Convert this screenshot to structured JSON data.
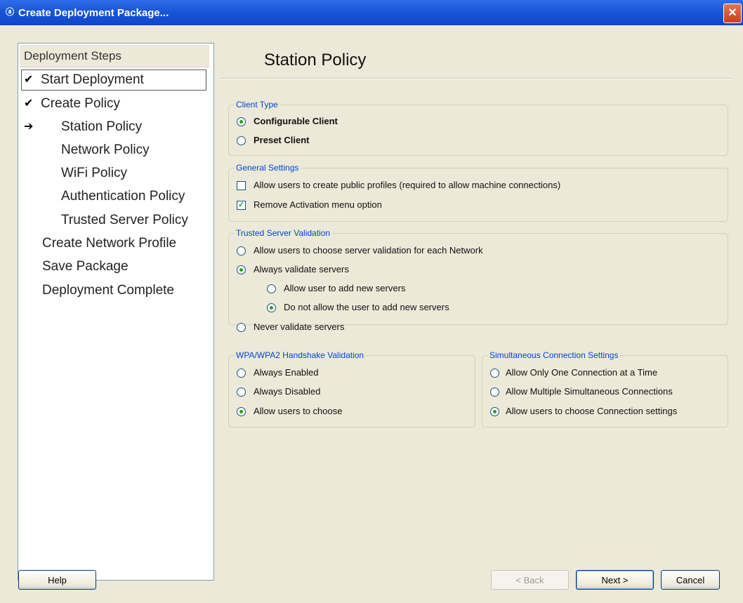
{
  "window": {
    "title": "Create Deployment Package...",
    "close_glyph": "✕"
  },
  "steps": {
    "header": "Deployment Steps",
    "items": [
      {
        "label": "Start Deployment",
        "mark": "✔"
      },
      {
        "label": "Create Policy",
        "mark": "✔"
      },
      {
        "label": "Station Policy",
        "mark": "➔"
      },
      {
        "label": "Network Policy",
        "mark": ""
      },
      {
        "label": "WiFi Policy",
        "mark": ""
      },
      {
        "label": "Authentication Policy",
        "mark": ""
      },
      {
        "label": "Trusted Server Policy",
        "mark": ""
      },
      {
        "label": "Create Network Profile",
        "mark": ""
      },
      {
        "label": "Save Package",
        "mark": ""
      },
      {
        "label": "Deployment Complete",
        "mark": ""
      }
    ]
  },
  "page": {
    "title": "Station Policy"
  },
  "client_type": {
    "legend": "Client Type",
    "options": [
      "Configurable Client",
      "Preset Client"
    ],
    "selected": "Configurable Client"
  },
  "general_settings": {
    "legend": "General Settings",
    "public_profiles": {
      "label": "Allow users to create public profiles (required to allow machine connections)",
      "checked": false
    },
    "remove_activation": {
      "label": "Remove Activation menu option",
      "checked": true,
      "check_glyph": "✓"
    }
  },
  "trusted_server": {
    "legend": "Trusted Server Validation",
    "options": [
      "Allow users to choose server validation for each Network",
      "Always validate servers",
      "Allow user to add new servers",
      "Do not allow the user to add new servers",
      "Never validate servers"
    ],
    "selected": "Always validate servers",
    "sub_selected": "Do not allow the user to add new servers"
  },
  "wpa_handshake": {
    "legend": "WPA/WPA2 Handshake Validation",
    "options": [
      "Always Enabled",
      "Always Disabled",
      "Allow users to choose"
    ],
    "selected": "Allow users to choose"
  },
  "simultaneous": {
    "legend": "Simultaneous Connection Settings",
    "options": [
      "Allow Only One Connection at a Time",
      "Allow Multiple Simultaneous Connections",
      "Allow users to choose Connection settings"
    ],
    "selected": "Allow users to choose Connection settings"
  },
  "buttons": {
    "help": "Help",
    "back": "< Back",
    "next": "Next >",
    "cancel": "Cancel"
  },
  "colors": {
    "title_bar": "#1a55d8",
    "legend_text": "#0046d5",
    "radio_selected": "#21a121"
  }
}
